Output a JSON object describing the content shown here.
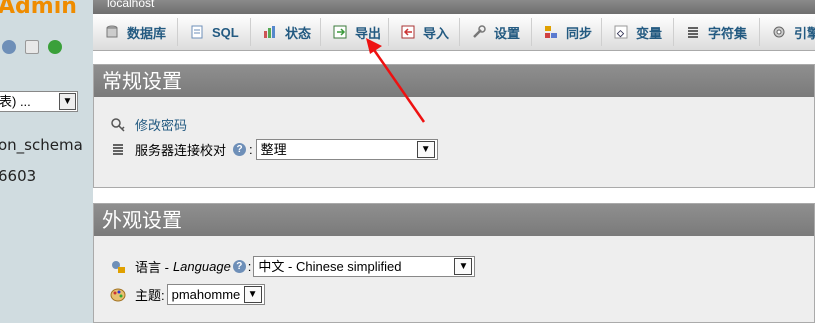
{
  "sidebar": {
    "logo": "Admin",
    "db_select_value": "表) ...",
    "tree_items": [
      "on_schema",
      "6603"
    ]
  },
  "main": {
    "server": "localhost",
    "tabs": [
      {
        "label": "数据库",
        "icon": "database-icon"
      },
      {
        "label": "SQL",
        "icon": "sql-icon"
      },
      {
        "label": "状态",
        "icon": "status-icon"
      },
      {
        "label": "导出",
        "icon": "export-icon"
      },
      {
        "label": "导入",
        "icon": "import-icon"
      },
      {
        "label": "设置",
        "icon": "settings-icon"
      },
      {
        "label": "同步",
        "icon": "sync-icon"
      },
      {
        "label": "变量",
        "icon": "variables-icon"
      },
      {
        "label": "字符集",
        "icon": "charset-icon"
      },
      {
        "label": "引擎",
        "icon": "engines-icon"
      }
    ],
    "general": {
      "title": "常规设置",
      "change_password": "修改密码",
      "collation_label": "服务器连接校对",
      "colon": ":",
      "collation_value": "整理"
    },
    "appearance": {
      "title": "外观设置",
      "language_label": "语言 -",
      "language_en": "Language",
      "language_value": "中文 - Chinese simplified",
      "theme_label": "主题:",
      "theme_value": "pmahomme"
    }
  },
  "colors": {
    "accent_link": "#235a81",
    "annotation_arrow": "#ee1111",
    "logo": "#ef8c00"
  }
}
